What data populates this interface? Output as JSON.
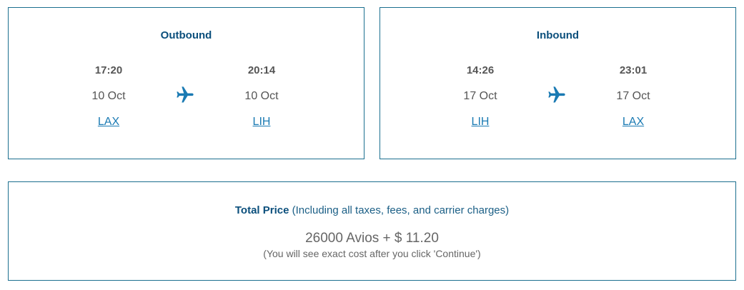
{
  "outbound": {
    "title": "Outbound",
    "departure": {
      "time": "17:20",
      "date": "10 Oct",
      "airport": "LAX"
    },
    "arrival": {
      "time": "20:14",
      "date": "10 Oct",
      "airport": "LIH"
    },
    "icon": "airplane-icon"
  },
  "inbound": {
    "title": "Inbound",
    "departure": {
      "time": "14:26",
      "date": "17 Oct",
      "airport": "LIH"
    },
    "arrival": {
      "time": "23:01",
      "date": "17 Oct",
      "airport": "LAX"
    },
    "icon": "airplane-icon"
  },
  "price": {
    "label": "Total Price",
    "note_inline": "(Including all taxes, fees, and carrier charges)",
    "amount": "26000 Avios + $ 11.20",
    "footnote": "(You will see exact cost after you click 'Continue')"
  },
  "colors": {
    "border": "#1b6f8f",
    "title": "#0b4f7c",
    "link": "#1a7ab3",
    "icon": "#1a7ab3"
  }
}
